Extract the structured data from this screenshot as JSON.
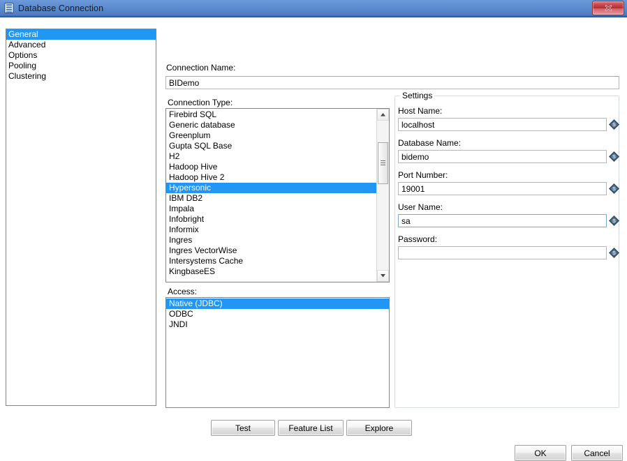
{
  "window": {
    "title": "Database Connection",
    "icon": "database-icon",
    "close_label": "Close",
    "close_icon": "close-x-icon",
    "titlebar_gradient_from": "#6c9adb",
    "titlebar_gradient_to": "#3d6bb0",
    "selection_color": "#2196f3"
  },
  "sidebar": {
    "items": [
      {
        "label": "General",
        "selected": true
      },
      {
        "label": "Advanced",
        "selected": false
      },
      {
        "label": "Options",
        "selected": false
      },
      {
        "label": "Pooling",
        "selected": false
      },
      {
        "label": "Clustering",
        "selected": false
      }
    ]
  },
  "main": {
    "connection_name": {
      "label": "Connection Name:",
      "value": "BIDemo",
      "placeholder": ""
    },
    "connection_type": {
      "label": "Connection Type:",
      "items": [
        {
          "label": "Firebird SQL",
          "selected": false
        },
        {
          "label": "Generic database",
          "selected": false
        },
        {
          "label": "Greenplum",
          "selected": false
        },
        {
          "label": "Gupta SQL Base",
          "selected": false
        },
        {
          "label": "H2",
          "selected": false
        },
        {
          "label": "Hadoop Hive",
          "selected": false
        },
        {
          "label": "Hadoop Hive 2",
          "selected": false
        },
        {
          "label": "Hypersonic",
          "selected": true
        },
        {
          "label": "IBM DB2",
          "selected": false
        },
        {
          "label": "Impala",
          "selected": false
        },
        {
          "label": "Infobright",
          "selected": false
        },
        {
          "label": "Informix",
          "selected": false
        },
        {
          "label": "Ingres",
          "selected": false
        },
        {
          "label": "Ingres VectorWise",
          "selected": false
        },
        {
          "label": "Intersystems Cache",
          "selected": false
        },
        {
          "label": "KingbaseES",
          "selected": false
        }
      ],
      "scrollbar": {
        "up_icon": "scroll-up-arrow-icon",
        "down_icon": "scroll-down-arrow-icon",
        "thumb_icon": "scrollbar-thumb"
      }
    },
    "access": {
      "label": "Access:",
      "items": [
        {
          "label": "Native (JDBC)",
          "selected": true
        },
        {
          "label": "ODBC",
          "selected": false
        },
        {
          "label": "JNDI",
          "selected": false
        }
      ]
    }
  },
  "settings": {
    "legend": "Settings",
    "fields": [
      {
        "label": "Host Name:",
        "value": "localhost",
        "placeholder": "",
        "focused": false,
        "icon": "variable-diamond-icon"
      },
      {
        "label": "Database Name:",
        "value": "bidemo",
        "placeholder": "",
        "focused": false,
        "icon": "variable-diamond-icon"
      },
      {
        "label": "Port Number:",
        "value": "19001",
        "placeholder": "",
        "focused": false,
        "icon": "variable-diamond-icon"
      },
      {
        "label": "User Name:",
        "value": "sa",
        "placeholder": "",
        "focused": true,
        "icon": "variable-diamond-icon"
      },
      {
        "label": "Password:",
        "value": "",
        "placeholder": "",
        "focused": false,
        "icon": "variable-diamond-icon"
      }
    ]
  },
  "actions": {
    "test": "Test",
    "feature_list": "Feature List",
    "explore": "Explore",
    "ok": "OK",
    "cancel": "Cancel"
  }
}
